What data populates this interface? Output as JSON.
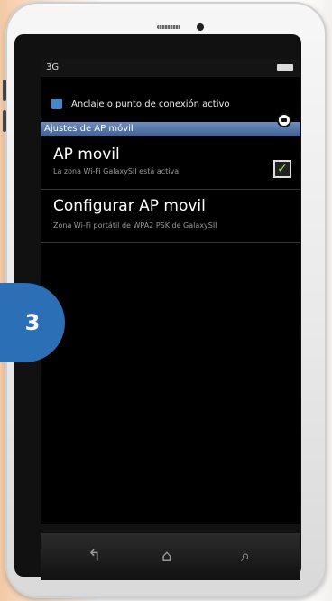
{
  "status_bar": {
    "network": "3G"
  },
  "notification": {
    "text": "Anclaje o punto de conexión activo"
  },
  "section_header": {
    "title": "Ajustes de AP móvil"
  },
  "settings": [
    {
      "title": "AP movil",
      "subtitle": "La zona Wi-Fi GalaxySII está activa"
    },
    {
      "title": "Configurar AP movil",
      "subtitle": "Zona Wi-Fi portátil de WPA2 PSK de GalaxySII"
    }
  ],
  "step_badge": {
    "number": "3"
  },
  "colors": {
    "header": "#3f5f95",
    "badge": "#2b6fb6",
    "check": "#9be05b"
  },
  "icons": {
    "back": "back-icon",
    "home": "home-icon",
    "search": "search-icon",
    "camera": "camera-icon",
    "checkbox": "checkbox-icon"
  }
}
